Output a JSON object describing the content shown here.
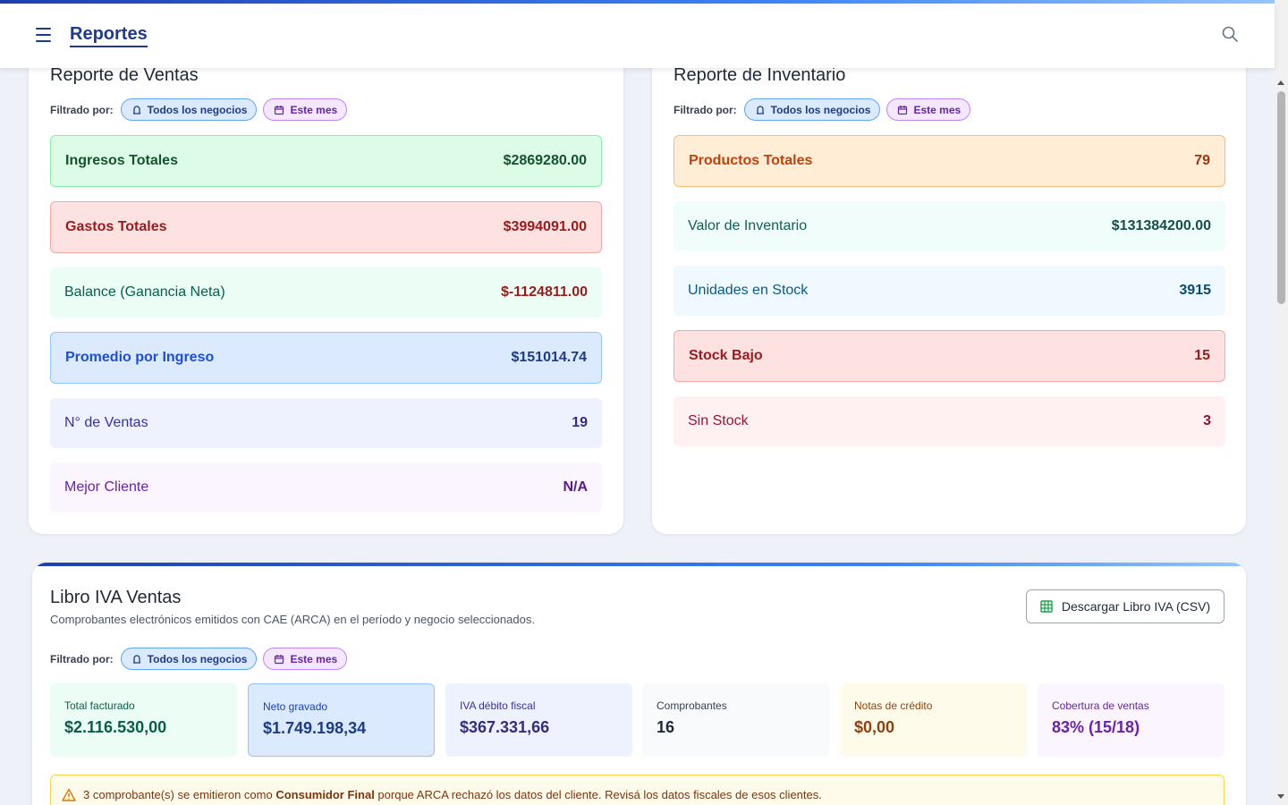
{
  "header": {
    "title": "Reportes",
    "menu_icon": "hamburger-menu-icon",
    "search_icon": "search-icon"
  },
  "filters": {
    "label": "Filtrado por:",
    "business_chip": "Todos los negocios",
    "date_chip": "Este mes"
  },
  "sales": {
    "title": "Reporte de Ventas",
    "rows": [
      {
        "label": "Ingresos Totales",
        "value": "$2869280.00"
      },
      {
        "label": "Gastos Totales",
        "value": "$3994091.00"
      },
      {
        "label": "Balance (Ganancia Neta)",
        "value": "$-1124811.00"
      },
      {
        "label": "Promedio por Ingreso",
        "value": "$151014.74"
      },
      {
        "label": "N° de Ventas",
        "value": "19"
      },
      {
        "label": "Mejor Cliente",
        "value": "N/A"
      }
    ]
  },
  "inventory": {
    "title": "Reporte de Inventario",
    "rows": [
      {
        "label": "Productos Totales",
        "value": "79"
      },
      {
        "label": "Valor de Inventario",
        "value": "$131384200.00"
      },
      {
        "label": "Unidades en Stock",
        "value": "3915"
      },
      {
        "label": "Stock Bajo",
        "value": "15"
      },
      {
        "label": "Sin Stock",
        "value": "3"
      }
    ]
  },
  "iva": {
    "title": "Libro IVA Ventas",
    "subtitle": "Comprobantes electrónicos emitidos con CAE (ARCA) en el período y negocio seleccionados.",
    "download_label": "Descargar Libro IVA (CSV)",
    "boxes": [
      {
        "label": "Total facturado",
        "value": "$2.116.530,00"
      },
      {
        "label": "Neto gravado",
        "value": "$1.749.198,34"
      },
      {
        "label": "IVA débito fiscal",
        "value": "$367.331,66"
      },
      {
        "label": "Comprobantes",
        "value": "16"
      },
      {
        "label": "Notas de crédito",
        "value": "$0,00"
      },
      {
        "label": "Cobertura de ventas",
        "value": "83% (15/18)"
      }
    ],
    "warning": {
      "prefix": "3 comprobante(s) se emitieron como ",
      "bold": "Consumidor Final",
      "suffix": " porque ARCA rechazó los datos del cliente. Revisá los datos fiscales de esos clientes."
    }
  },
  "colors": {
    "brand": "#1e3a8a",
    "accent_gradient_start": "#1e40af",
    "accent_gradient_end": "#93c5fd"
  }
}
